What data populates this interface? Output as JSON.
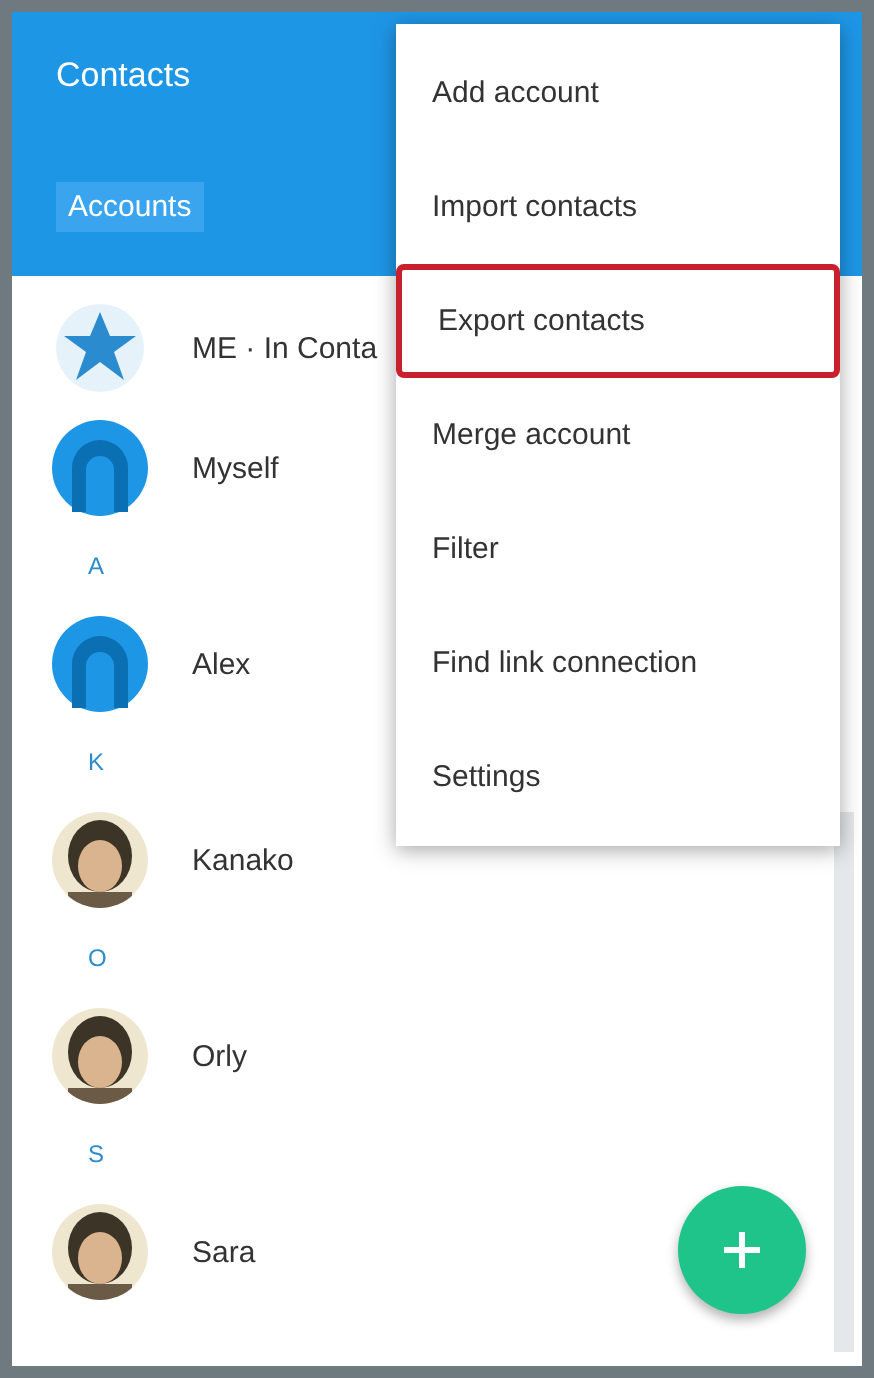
{
  "app_bar": {
    "title": "Contacts",
    "tab": "Accounts"
  },
  "contacts": [
    {
      "kind": "row",
      "avatar": {
        "kind": "logo"
      },
      "name": "ME · In Conta"
    },
    {
      "kind": "row",
      "avatar": {
        "kind": "silhouette"
      },
      "name": "Myself"
    },
    {
      "kind": "letter",
      "name": "A"
    },
    {
      "kind": "row",
      "avatar": {
        "kind": "silhouette"
      },
      "name": "Alex"
    },
    {
      "kind": "letter",
      "name": "K"
    },
    {
      "kind": "row",
      "name": "Kanako"
    },
    {
      "kind": "letter",
      "name": "O"
    },
    {
      "kind": "row",
      "name": "Orly"
    },
    {
      "kind": "letter",
      "name": "S"
    },
    {
      "kind": "row",
      "name": "Sara"
    }
  ],
  "menu": [
    {
      "label": "Add account",
      "highlighted": false
    },
    {
      "label": "Import contacts",
      "highlighted": false
    },
    {
      "label": "Export contacts",
      "highlighted": true
    },
    {
      "label": "Merge account",
      "highlighted": false
    },
    {
      "label": "Filter",
      "highlighted": false
    },
    {
      "label": "Find link connection",
      "highlighted": false
    },
    {
      "label": "Settings",
      "highlighted": false
    }
  ]
}
